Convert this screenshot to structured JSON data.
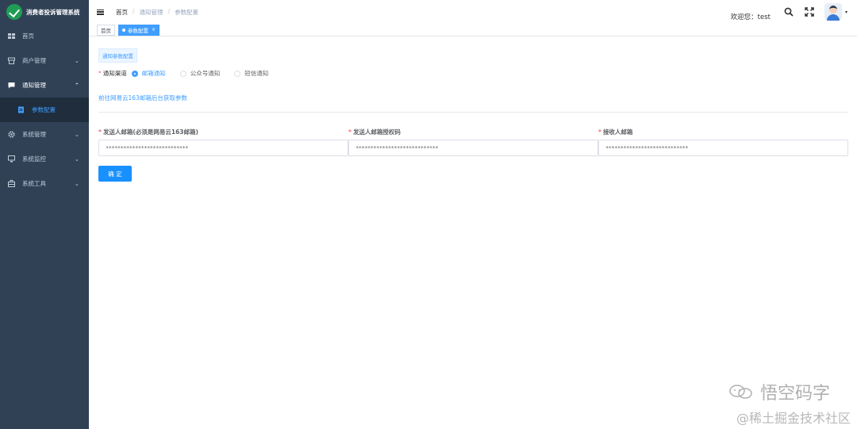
{
  "app": {
    "title": "消费者投诉管理系统"
  },
  "sidebar": {
    "items": [
      {
        "label": "首页",
        "icon": "dashboard-icon",
        "arrow": ""
      },
      {
        "label": "商户管理",
        "icon": "shop-icon",
        "arrow": "⌄"
      },
      {
        "label": "通知管理",
        "icon": "message-icon",
        "arrow": "⌃"
      },
      {
        "label": "系统管理",
        "icon": "gear-icon",
        "arrow": "⌄"
      },
      {
        "label": "系统监控",
        "icon": "monitor-icon",
        "arrow": "⌄"
      },
      {
        "label": "系统工具",
        "icon": "toolbox-icon",
        "arrow": "⌄"
      }
    ],
    "sub_item": {
      "label": "参数配置",
      "icon": "document-icon"
    }
  },
  "header": {
    "breadcrumb": [
      "首页",
      "通知管理",
      "参数配置"
    ],
    "breadcrumb_sep": "/",
    "welcome": "欢迎您：test",
    "caret": "▾"
  },
  "tags": [
    {
      "label": "首页",
      "active": false
    },
    {
      "label": "参数配置",
      "active": true,
      "close": "×"
    }
  ],
  "main": {
    "section_tag": "通知参数配置",
    "channel": {
      "required_mark": "*",
      "label": "通知渠道",
      "options": [
        "邮箱通知",
        "公众号通知",
        "短信通知"
      ],
      "selected": "邮箱通知"
    },
    "link": "前往网易云163邮箱后台获取参数",
    "fields": [
      {
        "label": "发送人邮箱(必须是网易云163邮箱)",
        "value": "****************************"
      },
      {
        "label": "发送人邮箱授权码",
        "value": "****************************"
      },
      {
        "label": "接收人邮箱",
        "value": "****************************"
      }
    ],
    "confirm_button": "确 定"
  },
  "watermark": {
    "line1": "悟空码字",
    "line2": "@稀土掘金技术社区"
  },
  "colors": {
    "sidebar_bg": "#304156",
    "sidebar_text": "#bfcbd9",
    "submenu_bg": "#1f2d3d",
    "primary": "#409eff",
    "button": "#1890ff",
    "required": "#f56c6c"
  }
}
